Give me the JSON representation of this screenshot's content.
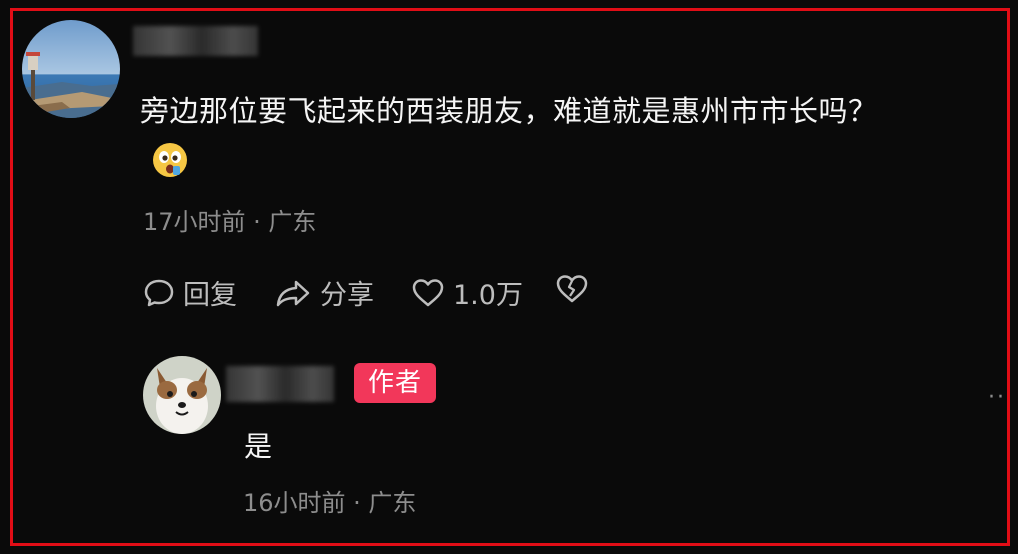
{
  "comment": {
    "text": "旁边那位要飞起来的西装朋友，难道就是惠州市市长吗？",
    "emoji_icon": "astonished-face-icon",
    "meta": "17小时前 · 广东",
    "actions": {
      "reply_label": "回复",
      "share_label": "分享",
      "like_count": "1.0万"
    }
  },
  "reply": {
    "badge": "作者",
    "text": "是",
    "meta": "16小时前 · 广东"
  },
  "colors": {
    "background": "#0a0a0a",
    "frame_border": "#e00d16",
    "author_badge": "#f2375a",
    "meta_text": "#8d8d8d"
  }
}
